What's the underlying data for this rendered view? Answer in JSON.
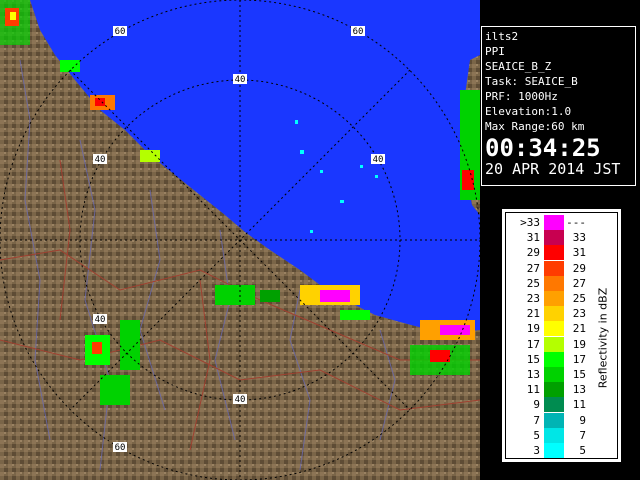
{
  "info": {
    "station": "ilts2",
    "scan_type": "PPI",
    "product": "SEAICE_B_Z",
    "task": "Task: SEAICE_B",
    "prf": "PRF: 1000Hz",
    "elevation": "Elevation:1.0",
    "max_range": "Max Range:60 km",
    "time": "00:34:25",
    "date": "20 APR 2014 JST"
  },
  "map": {
    "range_labels": [
      "60",
      "60",
      "40",
      "40",
      "40",
      "40",
      "40",
      "60"
    ],
    "colors": {
      "sea": "#1a37ff",
      "land": "#7a6548",
      "grid": "#000000"
    }
  },
  "legend": {
    "title": "Reflectivity in dBZ",
    "rows": [
      {
        "lo": ">33",
        "hi": "---",
        "color": "#ff00ff"
      },
      {
        "lo": "31",
        "hi": "33",
        "color": "#c80050"
      },
      {
        "lo": "29",
        "hi": "31",
        "color": "#ff0000"
      },
      {
        "lo": "27",
        "hi": "29",
        "color": "#ff3c00"
      },
      {
        "lo": "25",
        "hi": "27",
        "color": "#ff7800"
      },
      {
        "lo": "23",
        "hi": "25",
        "color": "#ffa000"
      },
      {
        "lo": "21",
        "hi": "23",
        "color": "#ffd200"
      },
      {
        "lo": "19",
        "hi": "21",
        "color": "#ffff00"
      },
      {
        "lo": "17",
        "hi": "19",
        "color": "#b4ff00"
      },
      {
        "lo": "15",
        "hi": "17",
        "color": "#00ff00"
      },
      {
        "lo": "13",
        "hi": "15",
        "color": "#00d200"
      },
      {
        "lo": "11",
        "hi": "13",
        "color": "#00a000"
      },
      {
        "lo": "9",
        "hi": "11",
        "color": "#008c50"
      },
      {
        "lo": "7",
        "hi": "9",
        "color": "#00b4b4"
      },
      {
        "lo": "5",
        "hi": "7",
        "color": "#00e6e6"
      },
      {
        "lo": "3",
        "hi": "5",
        "color": "#00ffff"
      }
    ]
  }
}
